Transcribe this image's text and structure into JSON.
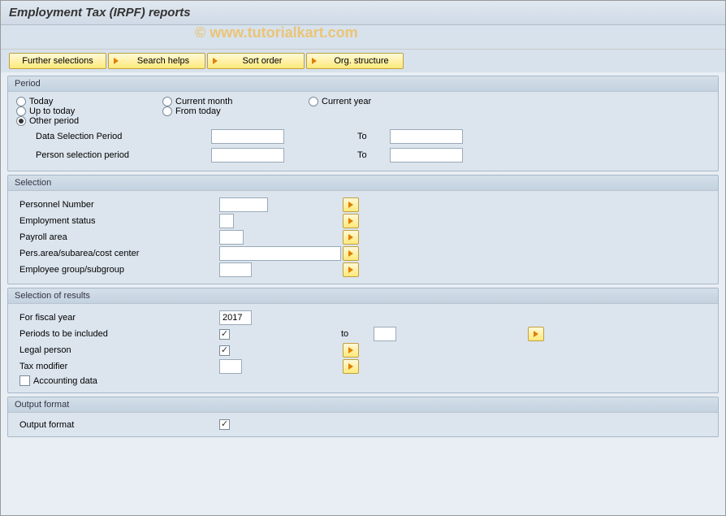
{
  "title": "Employment Tax (IRPF) reports",
  "watermark": "© www.tutorialkart.com",
  "toolbar": {
    "further_selections": "Further selections",
    "search_helps": "Search helps",
    "sort_order": "Sort order",
    "org_structure": "Org. structure"
  },
  "groups": {
    "period": {
      "title": "Period",
      "radios": {
        "today": "Today",
        "current_month": "Current month",
        "current_year": "Current year",
        "up_to_today": "Up to today",
        "from_today": "From today",
        "other_period": "Other period"
      },
      "data_selection_label": "Data Selection Period",
      "person_selection_label": "Person selection period",
      "to_label": "To",
      "data_from": "",
      "data_to": "",
      "person_from": "",
      "person_to": ""
    },
    "selection": {
      "title": "Selection",
      "personnel_number": "Personnel Number",
      "employment_status": "Employment status",
      "payroll_area": "Payroll area",
      "pers_area": "Pers.area/subarea/cost center",
      "employee_group": "Employee group/subgroup",
      "vals": {
        "pn": "",
        "es": "",
        "pa": "",
        "pac": "",
        "eg": ""
      }
    },
    "results": {
      "title": "Selection of results",
      "fiscal_year_label": "For fiscal year",
      "fiscal_year": "2017",
      "periods_label": "Periods to be included",
      "periods_to_label": "to",
      "periods_to_val": "",
      "legal_person_label": "Legal person",
      "legal_person_val": "",
      "tax_modifier_label": "Tax modifier",
      "tax_modifier_val": "",
      "accounting_data_label": "Accounting data"
    },
    "output": {
      "title": "Output format",
      "output_format_label": "Output format"
    }
  }
}
